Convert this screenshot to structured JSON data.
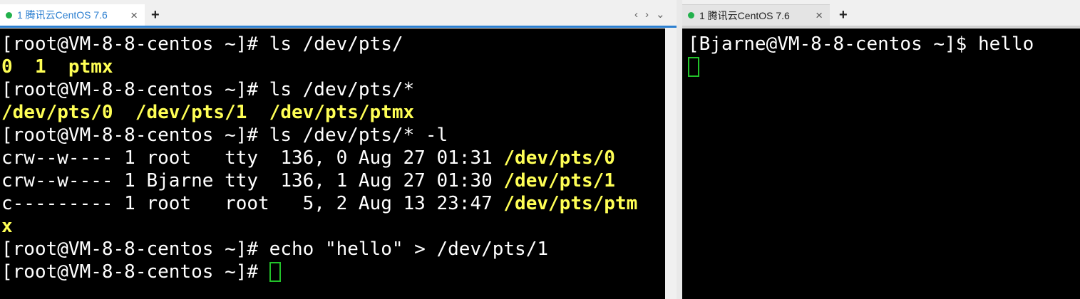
{
  "left": {
    "tab": {
      "title": "1 腾讯云CentOS 7.6",
      "status_color": "#22b14c",
      "active": true
    },
    "new_tab_label": "+",
    "nav": {
      "prev": "‹",
      "next": "›",
      "dropdown": "⌄"
    },
    "lines": [
      [
        {
          "t": "[root@VM-8-8-centos ~]# ls /dev/pts/",
          "y": false
        }
      ],
      [
        {
          "t": "0  1  ptmx",
          "y": true
        }
      ],
      [
        {
          "t": "[root@VM-8-8-centos ~]# ls /dev/pts/*",
          "y": false
        }
      ],
      [
        {
          "t": "/dev/pts/0  /dev/pts/1  /dev/pts/ptmx",
          "y": true
        }
      ],
      [
        {
          "t": "[root@VM-8-8-centos ~]# ls /dev/pts/* -l",
          "y": false
        }
      ],
      [
        {
          "t": "crw--w---- 1 root   tty  136, 0 Aug 27 01:31 ",
          "y": false
        },
        {
          "t": "/dev/pts/0",
          "y": true
        }
      ],
      [
        {
          "t": "crw--w---- 1 Bjarne tty  136, 1 Aug 27 01:30 ",
          "y": false
        },
        {
          "t": "/dev/pts/1",
          "y": true
        }
      ],
      [
        {
          "t": "c--------- 1 root   root   5, 2 Aug 13 23:47 ",
          "y": false
        },
        {
          "t": "/dev/pts/ptm",
          "y": true
        }
      ],
      [
        {
          "t": "x",
          "y": true
        }
      ],
      [
        {
          "t": "[root@VM-8-8-centos ~]# echo \"hello\" > /dev/pts/1",
          "y": false
        }
      ],
      [
        {
          "t": "[root@VM-8-8-centos ~]# ",
          "y": false
        },
        {
          "cursor": true
        }
      ]
    ]
  },
  "right": {
    "tab": {
      "title": "1 腾讯云CentOS 7.6",
      "status_color": "#22b14c",
      "active": false
    },
    "new_tab_label": "+",
    "lines": [
      [
        {
          "t": "[Bjarne@VM-8-8-centos ~]$ hello",
          "y": false
        }
      ],
      [
        {
          "cursor": true
        }
      ]
    ]
  },
  "close_label": "×",
  "colors": {
    "terminal_bg": "#000000",
    "text": "#ffffff",
    "highlight": "#ffff55",
    "cursor": "#22c22a",
    "active_tab_accent": "#2c7fd0"
  }
}
